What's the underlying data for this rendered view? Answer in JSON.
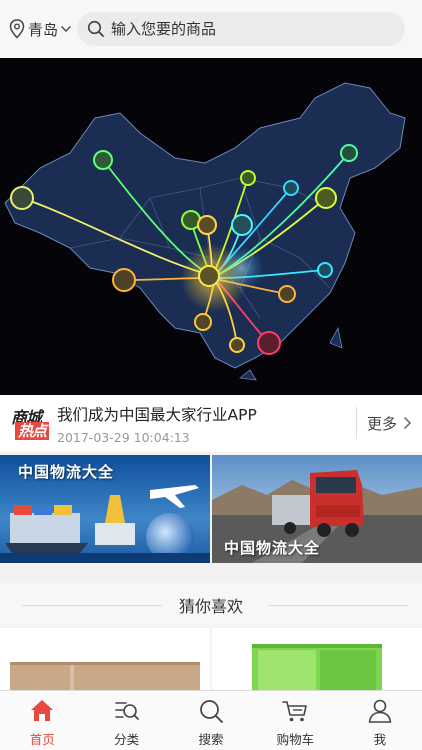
{
  "header": {
    "location": "青岛",
    "search_placeholder": "输入您要的商品"
  },
  "news": {
    "logo_line1": "商城",
    "logo_line2": "热点",
    "title": "我们成为中国最大家行业APP",
    "time": "2017-03-29 10:04:13",
    "more_label": "更多"
  },
  "promos": [
    {
      "label": "中国物流大全"
    },
    {
      "label": "中国物流大全"
    }
  ],
  "section": {
    "title": "猜你喜欢"
  },
  "tabs": [
    {
      "label": "首页",
      "icon": "home-icon",
      "active": true
    },
    {
      "label": "分类",
      "icon": "category-icon",
      "active": false
    },
    {
      "label": "搜索",
      "icon": "search-icon",
      "active": false
    },
    {
      "label": "购物车",
      "icon": "cart-icon",
      "active": false
    },
    {
      "label": "我",
      "icon": "user-icon",
      "active": false
    }
  ],
  "colors": {
    "accent": "#e8493f",
    "banner_bg": "#040409",
    "map_fill": "#1b2d52"
  }
}
